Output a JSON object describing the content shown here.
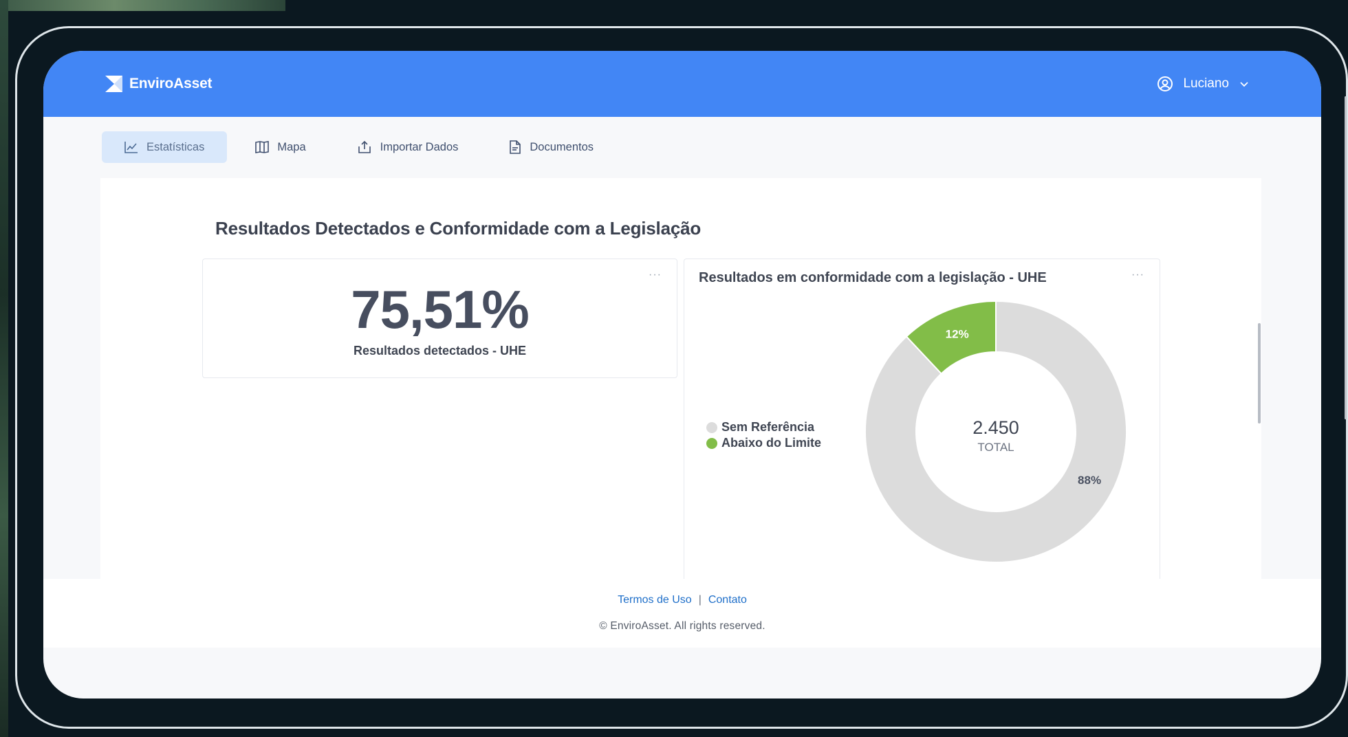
{
  "app": {
    "name": "EnviroAsset",
    "user": "Luciano"
  },
  "nav": [
    {
      "label": "Estatísticas",
      "icon": "chart-line-icon",
      "active": true
    },
    {
      "label": "Mapa",
      "icon": "map-icon",
      "active": false
    },
    {
      "label": "Importar Dados",
      "icon": "upload-icon",
      "active": false
    },
    {
      "label": "Documentos",
      "icon": "document-icon",
      "active": false
    }
  ],
  "section": {
    "title": "Resultados Detectados e Conformidade com a Legislação"
  },
  "kpi": {
    "value": "75,51%",
    "label": "Resultados detectados - UHE",
    "more": "···"
  },
  "chart": {
    "more": "···",
    "center_value": "2.450",
    "center_label": "TOTAL"
  },
  "chart_data": {
    "type": "pie",
    "title": "Resultados em conformidade com a legislação - UHE",
    "categories": [
      "Sem Referência",
      "Abaixo do Limite"
    ],
    "values": [
      88,
      12
    ],
    "labels": [
      "88%",
      "12%"
    ],
    "colors": [
      "#dcdcdc",
      "#82bd48"
    ],
    "legend": "left",
    "total": "2.450"
  },
  "footer": {
    "terms": "Termos de Uso",
    "separator": "|",
    "contact": "Contato",
    "copyright": "© EnviroAsset. All rights reserved."
  },
  "colors": {
    "header": "#4286f5",
    "nav_active_bg": "#d9e8fb",
    "link": "#1f6fc9"
  }
}
